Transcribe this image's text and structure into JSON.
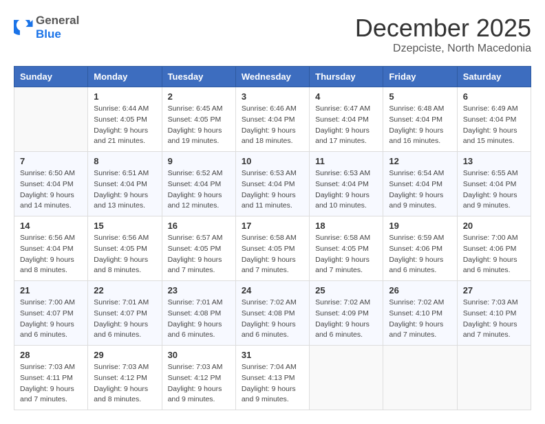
{
  "header": {
    "logo_general": "General",
    "logo_blue": "Blue",
    "month": "December 2025",
    "location": "Dzepciste, North Macedonia"
  },
  "weekdays": [
    "Sunday",
    "Monday",
    "Tuesday",
    "Wednesday",
    "Thursday",
    "Friday",
    "Saturday"
  ],
  "weeks": [
    [
      {
        "day": "",
        "sunrise": "",
        "sunset": "",
        "daylight": ""
      },
      {
        "day": "1",
        "sunrise": "Sunrise: 6:44 AM",
        "sunset": "Sunset: 4:05 PM",
        "daylight": "Daylight: 9 hours and 21 minutes."
      },
      {
        "day": "2",
        "sunrise": "Sunrise: 6:45 AM",
        "sunset": "Sunset: 4:05 PM",
        "daylight": "Daylight: 9 hours and 19 minutes."
      },
      {
        "day": "3",
        "sunrise": "Sunrise: 6:46 AM",
        "sunset": "Sunset: 4:04 PM",
        "daylight": "Daylight: 9 hours and 18 minutes."
      },
      {
        "day": "4",
        "sunrise": "Sunrise: 6:47 AM",
        "sunset": "Sunset: 4:04 PM",
        "daylight": "Daylight: 9 hours and 17 minutes."
      },
      {
        "day": "5",
        "sunrise": "Sunrise: 6:48 AM",
        "sunset": "Sunset: 4:04 PM",
        "daylight": "Daylight: 9 hours and 16 minutes."
      },
      {
        "day": "6",
        "sunrise": "Sunrise: 6:49 AM",
        "sunset": "Sunset: 4:04 PM",
        "daylight": "Daylight: 9 hours and 15 minutes."
      }
    ],
    [
      {
        "day": "7",
        "sunrise": "Sunrise: 6:50 AM",
        "sunset": "Sunset: 4:04 PM",
        "daylight": "Daylight: 9 hours and 14 minutes."
      },
      {
        "day": "8",
        "sunrise": "Sunrise: 6:51 AM",
        "sunset": "Sunset: 4:04 PM",
        "daylight": "Daylight: 9 hours and 13 minutes."
      },
      {
        "day": "9",
        "sunrise": "Sunrise: 6:52 AM",
        "sunset": "Sunset: 4:04 PM",
        "daylight": "Daylight: 9 hours and 12 minutes."
      },
      {
        "day": "10",
        "sunrise": "Sunrise: 6:53 AM",
        "sunset": "Sunset: 4:04 PM",
        "daylight": "Daylight: 9 hours and 11 minutes."
      },
      {
        "day": "11",
        "sunrise": "Sunrise: 6:53 AM",
        "sunset": "Sunset: 4:04 PM",
        "daylight": "Daylight: 9 hours and 10 minutes."
      },
      {
        "day": "12",
        "sunrise": "Sunrise: 6:54 AM",
        "sunset": "Sunset: 4:04 PM",
        "daylight": "Daylight: 9 hours and 9 minutes."
      },
      {
        "day": "13",
        "sunrise": "Sunrise: 6:55 AM",
        "sunset": "Sunset: 4:04 PM",
        "daylight": "Daylight: 9 hours and 9 minutes."
      }
    ],
    [
      {
        "day": "14",
        "sunrise": "Sunrise: 6:56 AM",
        "sunset": "Sunset: 4:04 PM",
        "daylight": "Daylight: 9 hours and 8 minutes."
      },
      {
        "day": "15",
        "sunrise": "Sunrise: 6:56 AM",
        "sunset": "Sunset: 4:05 PM",
        "daylight": "Daylight: 9 hours and 8 minutes."
      },
      {
        "day": "16",
        "sunrise": "Sunrise: 6:57 AM",
        "sunset": "Sunset: 4:05 PM",
        "daylight": "Daylight: 9 hours and 7 minutes."
      },
      {
        "day": "17",
        "sunrise": "Sunrise: 6:58 AM",
        "sunset": "Sunset: 4:05 PM",
        "daylight": "Daylight: 9 hours and 7 minutes."
      },
      {
        "day": "18",
        "sunrise": "Sunrise: 6:58 AM",
        "sunset": "Sunset: 4:05 PM",
        "daylight": "Daylight: 9 hours and 7 minutes."
      },
      {
        "day": "19",
        "sunrise": "Sunrise: 6:59 AM",
        "sunset": "Sunset: 4:06 PM",
        "daylight": "Daylight: 9 hours and 6 minutes."
      },
      {
        "day": "20",
        "sunrise": "Sunrise: 7:00 AM",
        "sunset": "Sunset: 4:06 PM",
        "daylight": "Daylight: 9 hours and 6 minutes."
      }
    ],
    [
      {
        "day": "21",
        "sunrise": "Sunrise: 7:00 AM",
        "sunset": "Sunset: 4:07 PM",
        "daylight": "Daylight: 9 hours and 6 minutes."
      },
      {
        "day": "22",
        "sunrise": "Sunrise: 7:01 AM",
        "sunset": "Sunset: 4:07 PM",
        "daylight": "Daylight: 9 hours and 6 minutes."
      },
      {
        "day": "23",
        "sunrise": "Sunrise: 7:01 AM",
        "sunset": "Sunset: 4:08 PM",
        "daylight": "Daylight: 9 hours and 6 minutes."
      },
      {
        "day": "24",
        "sunrise": "Sunrise: 7:02 AM",
        "sunset": "Sunset: 4:08 PM",
        "daylight": "Daylight: 9 hours and 6 minutes."
      },
      {
        "day": "25",
        "sunrise": "Sunrise: 7:02 AM",
        "sunset": "Sunset: 4:09 PM",
        "daylight": "Daylight: 9 hours and 6 minutes."
      },
      {
        "day": "26",
        "sunrise": "Sunrise: 7:02 AM",
        "sunset": "Sunset: 4:10 PM",
        "daylight": "Daylight: 9 hours and 7 minutes."
      },
      {
        "day": "27",
        "sunrise": "Sunrise: 7:03 AM",
        "sunset": "Sunset: 4:10 PM",
        "daylight": "Daylight: 9 hours and 7 minutes."
      }
    ],
    [
      {
        "day": "28",
        "sunrise": "Sunrise: 7:03 AM",
        "sunset": "Sunset: 4:11 PM",
        "daylight": "Daylight: 9 hours and 7 minutes."
      },
      {
        "day": "29",
        "sunrise": "Sunrise: 7:03 AM",
        "sunset": "Sunset: 4:12 PM",
        "daylight": "Daylight: 9 hours and 8 minutes."
      },
      {
        "day": "30",
        "sunrise": "Sunrise: 7:03 AM",
        "sunset": "Sunset: 4:12 PM",
        "daylight": "Daylight: 9 hours and 9 minutes."
      },
      {
        "day": "31",
        "sunrise": "Sunrise: 7:04 AM",
        "sunset": "Sunset: 4:13 PM",
        "daylight": "Daylight: 9 hours and 9 minutes."
      },
      {
        "day": "",
        "sunrise": "",
        "sunset": "",
        "daylight": ""
      },
      {
        "day": "",
        "sunrise": "",
        "sunset": "",
        "daylight": ""
      },
      {
        "day": "",
        "sunrise": "",
        "sunset": "",
        "daylight": ""
      }
    ]
  ]
}
